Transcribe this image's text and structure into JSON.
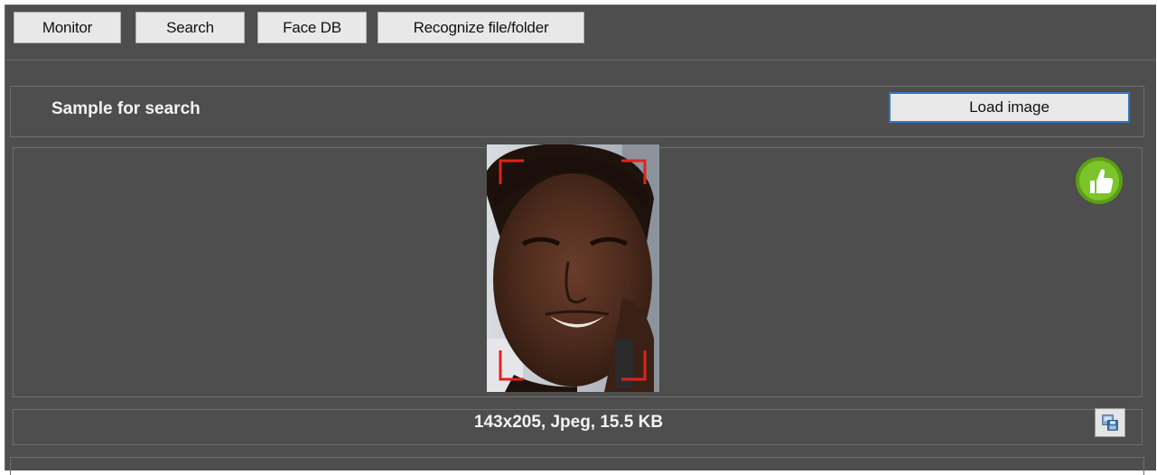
{
  "toolbar": {
    "monitor": "Monitor",
    "search": "Search",
    "face_db": "Face DB",
    "recognize": "Recognize file/folder"
  },
  "sample": {
    "title": "Sample for search",
    "load_button": "Load image",
    "image_info": "143x205, Jpeg, 15.5 KB",
    "status_icon": "thumbs-up-icon",
    "save_icon": "save-image-icon",
    "status_color": "#6fb21e",
    "face_box_color": "#e0221c"
  }
}
